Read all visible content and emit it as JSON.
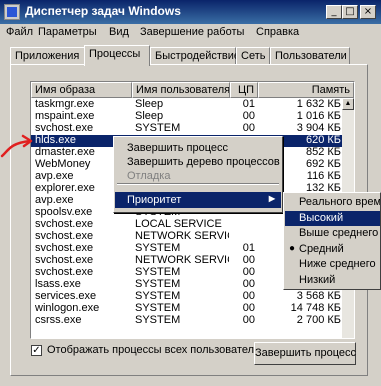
{
  "window": {
    "title": "Диспетчер задач Windows"
  },
  "menu": [
    "Файл",
    "Параметры",
    "Вид",
    "Завершение работы",
    "Справка"
  ],
  "tabs": [
    "Приложения",
    "Процессы",
    "Быстродействие",
    "Сеть",
    "Пользователи"
  ],
  "active_tab": "Процессы",
  "columns": [
    "Имя образа",
    "Имя пользователя",
    "ЦП",
    "Память"
  ],
  "processes": [
    {
      "name": "taskmgr.exe",
      "user": "Sleep",
      "cpu": "01",
      "mem": "1 632 КБ"
    },
    {
      "name": "mspaint.exe",
      "user": "Sleep",
      "cpu": "00",
      "mem": "1 016 КБ"
    },
    {
      "name": "svchost.exe",
      "user": "SYSTEM",
      "cpu": "00",
      "mem": "3 904 КБ"
    },
    {
      "name": "hlds.exe",
      "user": "",
      "cpu": "",
      "mem": "620 КБ"
    },
    {
      "name": "dmaster.exe",
      "user": "",
      "cpu": "",
      "mem": "852 КБ"
    },
    {
      "name": "WebMoney",
      "user": "",
      "cpu": "",
      "mem": "692 КБ"
    },
    {
      "name": "avp.exe",
      "user": "",
      "cpu": "",
      "mem": "116 КБ"
    },
    {
      "name": "explorer.exe",
      "user": "",
      "cpu": "",
      "mem": "132 КБ"
    },
    {
      "name": "avp.exe",
      "user": "",
      "cpu": "",
      "mem": ""
    },
    {
      "name": "spoolsv.exe",
      "user": "SYSTEM",
      "cpu": "",
      "mem": ""
    },
    {
      "name": "svchost.exe",
      "user": "LOCAL SERVICE",
      "cpu": "",
      "mem": ""
    },
    {
      "name": "svchost.exe",
      "user": "NETWORK SERVICE",
      "cpu": "",
      "mem": ""
    },
    {
      "name": "svchost.exe",
      "user": "SYSTEM",
      "cpu": "01",
      "mem": "31"
    },
    {
      "name": "svchost.exe",
      "user": "NETWORK SERVICE",
      "cpu": "00",
      "mem": "3"
    },
    {
      "name": "svchost.exe",
      "user": "SYSTEM",
      "cpu": "00",
      "mem": ""
    },
    {
      "name": "lsass.exe",
      "user": "SYSTEM",
      "cpu": "00",
      "mem": "980 КБ"
    },
    {
      "name": "services.exe",
      "user": "SYSTEM",
      "cpu": "00",
      "mem": "3 568 КБ"
    },
    {
      "name": "winlogon.exe",
      "user": "SYSTEM",
      "cpu": "00",
      "mem": "14 748 КБ"
    },
    {
      "name": "csrss.exe",
      "user": "SYSTEM",
      "cpu": "00",
      "mem": "2 700 КБ"
    }
  ],
  "selected_row": 3,
  "show_all_label": "Отображать процессы всех пользователей",
  "show_all_checked": "✓",
  "end_process_button": "Завершить процесс",
  "context_menu": {
    "end_process": "Завершить процесс",
    "end_tree": "Завершить дерево процессов",
    "debug": "Отладка",
    "priority": "Приоритет"
  },
  "priority_menu": [
    "Реального времени",
    "Высокий",
    "Выше среднего",
    "Средний",
    "Ниже среднего",
    "Низкий"
  ],
  "priority_highlighted": "Высокий",
  "priority_selected": "Средний",
  "colors": {
    "selection": "#0a246a",
    "title_start": "#0a246a",
    "title_end": "#3a6ea5",
    "annotation": "#e02020"
  }
}
